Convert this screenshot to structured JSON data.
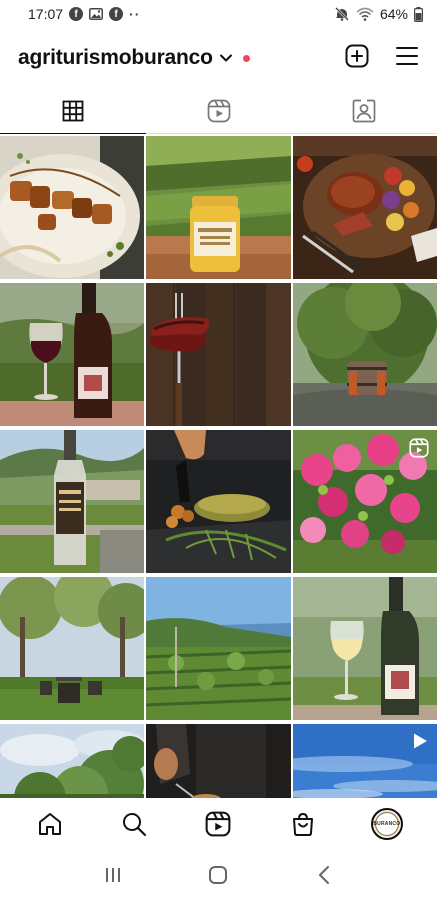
{
  "status_bar": {
    "time": "17:07",
    "battery": "64%",
    "left_icons": [
      "facebook-icon",
      "gallery-icon",
      "facebook-icon",
      "more-dots"
    ],
    "right_icons": [
      "mute-icon",
      "wifi-icon",
      "battery-icon"
    ]
  },
  "header": {
    "username": "agriturismoburanco",
    "has_notification_dot": true,
    "notification_color": "#ed4956"
  },
  "tabs": [
    {
      "name": "posts-grid",
      "icon": "grid-icon",
      "active": true
    },
    {
      "name": "reels",
      "icon": "reels-icon",
      "active": false
    },
    {
      "name": "tagged",
      "icon": "tagged-user-icon",
      "active": false
    }
  ],
  "grid_posts": [
    {
      "subject": "grilled chicken skewers on plate",
      "type": "photo"
    },
    {
      "subject": "jar of honey in front of vineyard terraces",
      "type": "photo"
    },
    {
      "subject": "grilled steak platter with vegetables",
      "type": "photo"
    },
    {
      "subject": "glass of red wine with bottle",
      "type": "photo"
    },
    {
      "subject": "sliced steak on meat fork",
      "type": "photo"
    },
    {
      "subject": "wooden barrel seat under tree",
      "type": "photo"
    },
    {
      "subject": "bottle of grappa overlooking village",
      "type": "photo"
    },
    {
      "subject": "plated dish with herbs",
      "type": "photo"
    },
    {
      "subject": "pink geranium flowers",
      "type": "reel"
    },
    {
      "subject": "olive grove with garden chairs",
      "type": "photo"
    },
    {
      "subject": "vineyard with sea view",
      "type": "photo"
    },
    {
      "subject": "glass of white wine with bottle",
      "type": "photo"
    },
    {
      "subject": "tree against cloudy sky",
      "type": "photo"
    },
    {
      "subject": "chef at work",
      "type": "photo"
    },
    {
      "subject": "blue sky over landscape",
      "type": "video"
    }
  ],
  "avatar_text": "BURANCO",
  "bottom_nav": [
    "home-icon",
    "search-icon",
    "reels-icon",
    "shop-icon",
    "profile-avatar"
  ],
  "system_nav": [
    "recent-apps-icon",
    "home-circle-icon",
    "back-icon"
  ]
}
